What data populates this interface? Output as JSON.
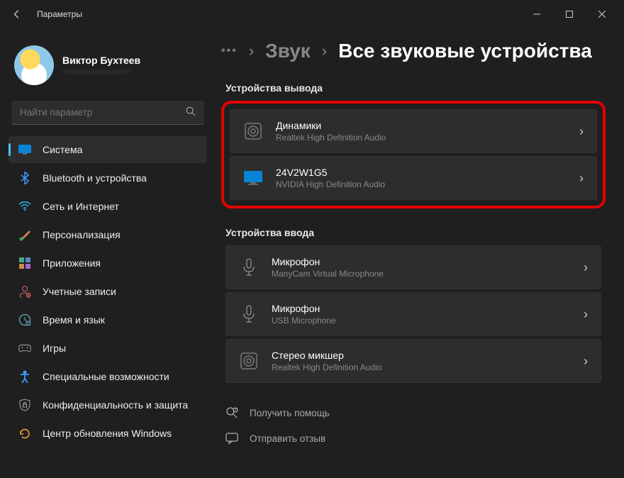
{
  "titlebar": {
    "title": "Параметры"
  },
  "profile": {
    "name": "Виктор Бухтеев",
    "email": "————————"
  },
  "search": {
    "placeholder": "Найти параметр"
  },
  "nav": {
    "items": [
      {
        "label": "Система"
      },
      {
        "label": "Bluetooth и устройства"
      },
      {
        "label": "Сеть и Интернет"
      },
      {
        "label": "Персонализация"
      },
      {
        "label": "Приложения"
      },
      {
        "label": "Учетные записи"
      },
      {
        "label": "Время и язык"
      },
      {
        "label": "Игры"
      },
      {
        "label": "Специальные возможности"
      },
      {
        "label": "Конфиденциальность и защита"
      },
      {
        "label": "Центр обновления Windows"
      }
    ]
  },
  "breadcrumb": {
    "dots": "•••",
    "part1": "Звук",
    "part2": "Все звуковые устройства"
  },
  "sections": {
    "output_label": "Устройства вывода",
    "input_label": "Устройства ввода"
  },
  "output_devices": [
    {
      "title": "Динамики",
      "subtitle": "Realtek High Definition Audio"
    },
    {
      "title": "24V2W1G5",
      "subtitle": "NVIDIA High Definition Audio"
    }
  ],
  "input_devices": [
    {
      "title": "Микрофон",
      "subtitle": "ManyCam Virtual Microphone"
    },
    {
      "title": "Микрофон",
      "subtitle": "USB Microphone"
    },
    {
      "title": "Стерео микшер",
      "subtitle": "Realtek High Definition Audio"
    }
  ],
  "help": {
    "get_help": "Получить помощь",
    "feedback": "Отправить отзыв"
  }
}
